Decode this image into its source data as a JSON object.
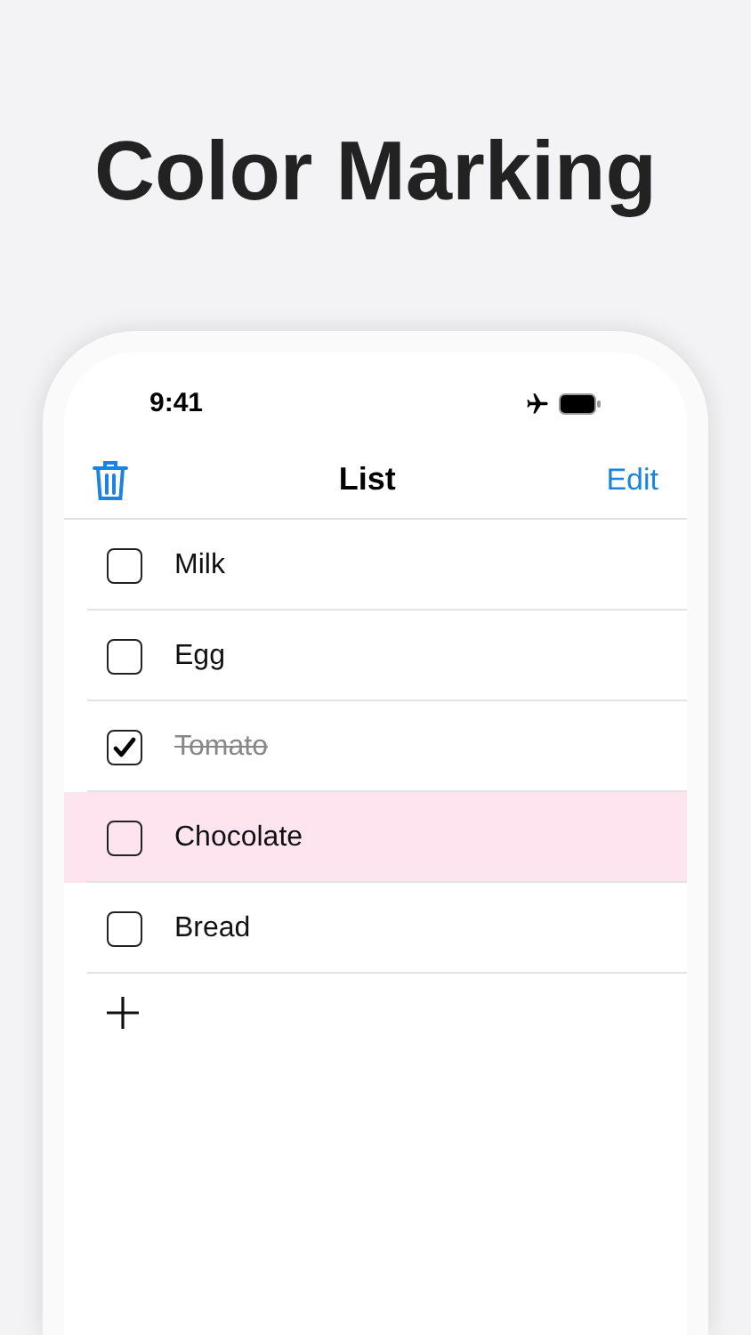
{
  "headline": "Color Marking",
  "status_bar": {
    "time": "9:41"
  },
  "nav": {
    "title": "List",
    "edit": "Edit"
  },
  "items": [
    {
      "label": "Milk",
      "checked": false
    },
    {
      "label": "Egg",
      "checked": false
    },
    {
      "label": "Tomato",
      "checked": true
    },
    {
      "label": "Chocolate",
      "checked": false,
      "color": "#fde4ef"
    },
    {
      "label": "Bread",
      "checked": false
    }
  ]
}
